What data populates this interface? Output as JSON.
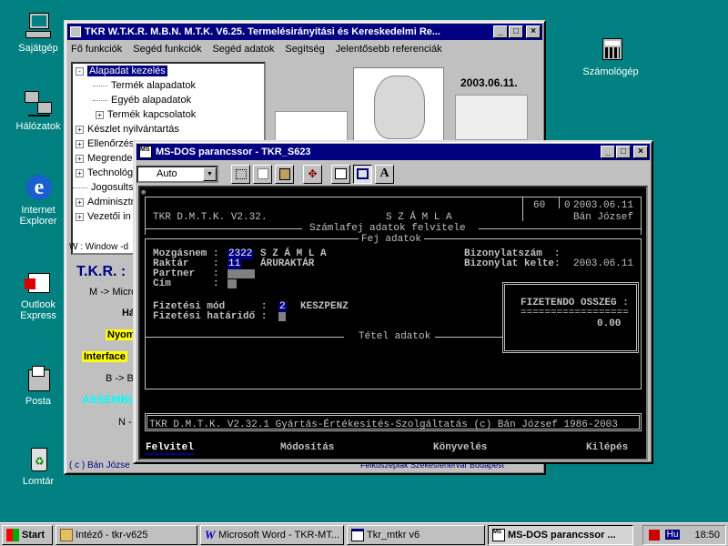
{
  "desktop": {
    "icons": [
      {
        "label": "Sajátgép"
      },
      {
        "label": "Hálózatok"
      },
      {
        "label": "Internet Explorer"
      },
      {
        "label": "Outlook Express"
      },
      {
        "label": "Posta"
      },
      {
        "label": "Lomtár"
      },
      {
        "label": "Számológép"
      }
    ]
  },
  "main_window": {
    "title": "TKR W.T.K.R. M.B.N. M.T.K. V6.25. Termelésirányítási és Kereskedelmi Re...",
    "menu": [
      "Fő funkciók",
      "Segéd funkciók",
      "Segéd adatok",
      "Segítség",
      "Jelentősebb referenciák"
    ],
    "tree": [
      {
        "label": "Alapadat kezelés",
        "exp": "-",
        "level": 0,
        "selected": true
      },
      {
        "label": "Termék alapadatok",
        "exp": "",
        "level": 1
      },
      {
        "label": "Egyéb alapadatok",
        "exp": "",
        "level": 1
      },
      {
        "label": "Termék kapcsolatok",
        "exp": "+",
        "level": 1
      },
      {
        "label": "Készlet nyilvántartás",
        "exp": "+",
        "level": 0
      },
      {
        "label": "Ellenőrzés",
        "exp": "+",
        "level": 0
      },
      {
        "label": "Megrende",
        "exp": "+",
        "level": 0
      },
      {
        "label": "Technológ",
        "exp": "+",
        "level": 0
      },
      {
        "label": "Jogosults",
        "exp": "",
        "level": 0
      },
      {
        "label": "Adminisztr",
        "exp": "+",
        "level": 0
      },
      {
        "label": "Vezetői in",
        "exp": "+",
        "level": 0
      }
    ],
    "date": "2003.06.11.",
    "status": "W : Window -d",
    "brand": "T.K.R. :",
    "lines": [
      "M -> Micro",
      "Há",
      "Nyom",
      "Interface",
      "B -> B",
      "ASSEMBL",
      "N -"
    ],
    "footer_left": "( c ) Bán Józse",
    "footer_right": "Felküszépiak Székesfehérvár Budapest"
  },
  "dos_window": {
    "title": "MS-DOS parancssor - TKR_S623",
    "font_select": "Auto",
    "screen": {
      "header_left": "TKR D.M.T.K. V2.32.",
      "header_center": "S Z Á M L A",
      "header_right_a": "60",
      "header_right_b": "0",
      "header_date": "2003.06.11",
      "header_user": "Bán József",
      "subtitle": "Számlafej adatok felvitele",
      "fej": "Fej adatok",
      "mozgasnem_label": "Mozgásnem :",
      "mozgasnem_value": "2322",
      "mozgasnem_text": "S Z Á M L A",
      "raktar_label": "Raktár    :",
      "raktar_value": "11",
      "raktar_text": "ÁRURAKTÁR",
      "partner_label": "Partner   :",
      "cim_label": "Cím       :",
      "bizonylatszam": "Bizonylatszám  :",
      "bizonylat_kelte": "Bizonylat kelte:",
      "bizonylat_kelte_value": "2003.06.11",
      "fizmod_label": "Fizetési mód      :",
      "fizmod_value": "2",
      "fizmod_text": "KESZPENZ",
      "fizhat_label": "Fizetési határidő :",
      "osszeg_label": "FIZETENDO OSSZEG :",
      "osszeg_line": "==================",
      "osszeg_value": "0.00",
      "tetel": "Tétel adatok",
      "footer": "TKR D.M.T.K. V2.32.1 Gyártás-Értékesítés-Szolgáltatás (c) Bán József 1986-2003",
      "menu": [
        "Felvitel",
        "Módosítás",
        "Könyvelés",
        "Kilépés"
      ]
    }
  },
  "taskbar": {
    "start": "Start",
    "items": [
      "Intéző - tkr-v625",
      "Microsoft Word - TKR-MT...",
      "Tkr_mtkr v6",
      "MS-DOS parancssor ..."
    ],
    "lang": "Hu",
    "clock": "18:50"
  }
}
